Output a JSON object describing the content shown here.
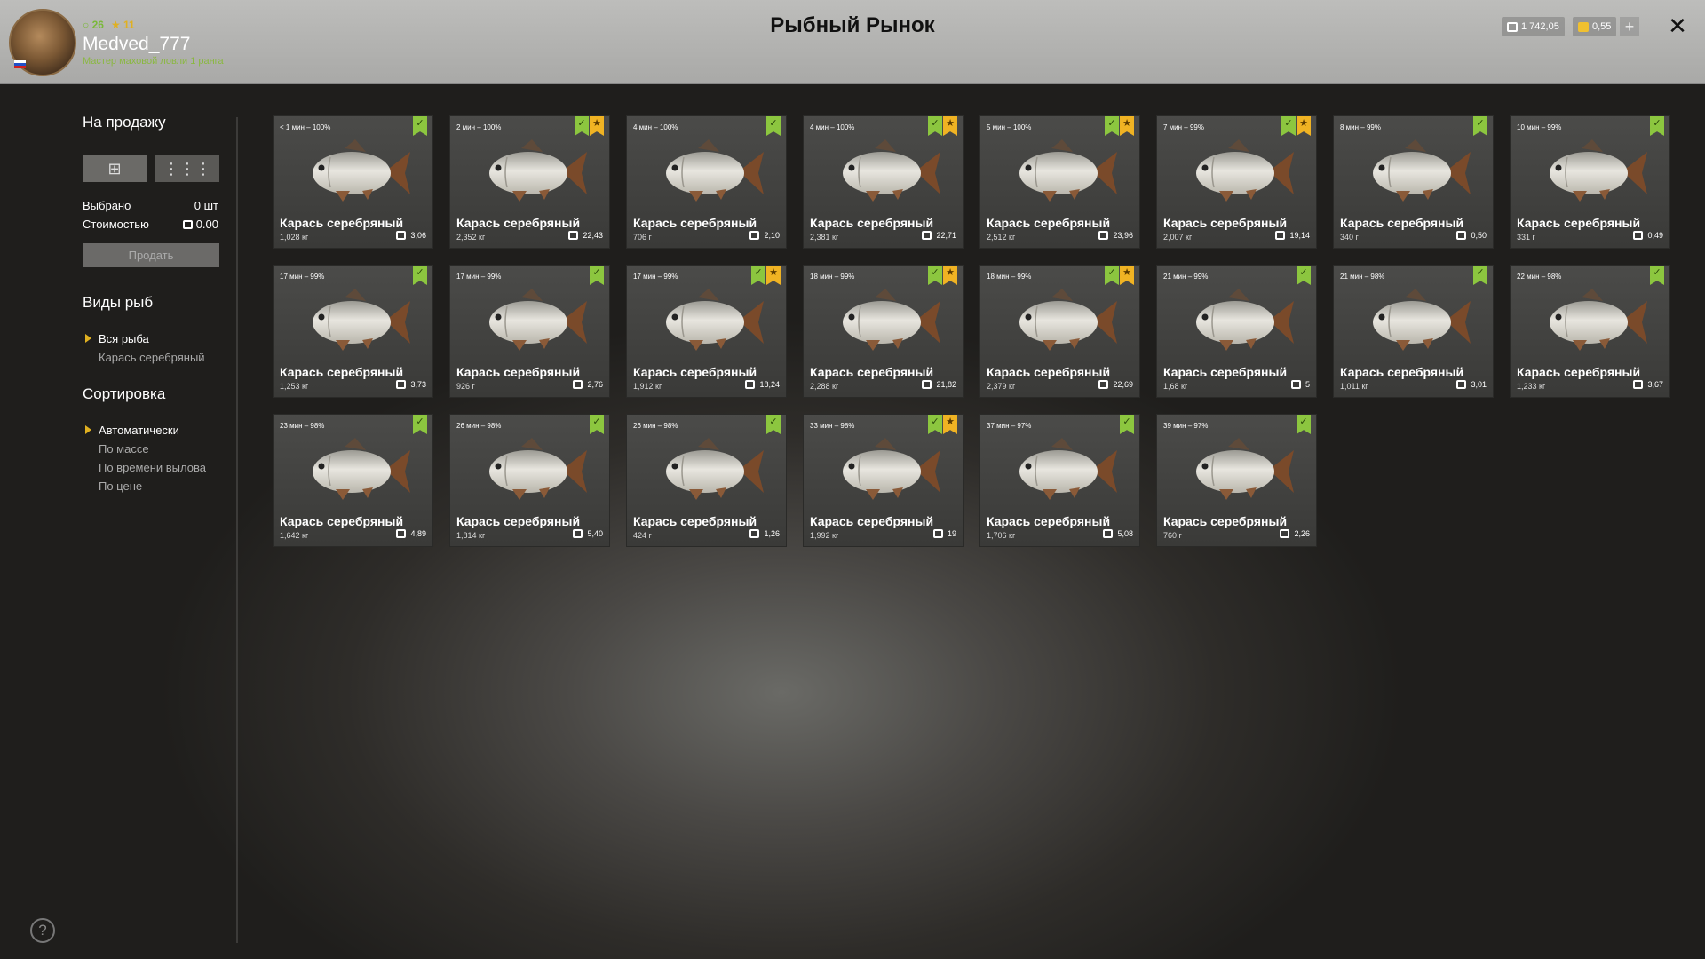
{
  "header": {
    "title": "Рыбный Рынок",
    "user": {
      "level": "26",
      "stars": "11",
      "name": "Medved_777",
      "rank_title": "Мастер маховой ловли 1 ранга"
    },
    "currency": {
      "silver": "1 742,05",
      "gold": "0,55"
    },
    "plus_label": "+",
    "close_label": "✕"
  },
  "sidebar": {
    "for_sale_heading": "На продажу",
    "selected_label": "Выбрано",
    "selected_value": "0 шт",
    "cost_label": "Стоимостью",
    "cost_value": "0.00",
    "sell_button": "Продать",
    "species_heading": "Виды рыб",
    "species": [
      "Вся рыба",
      "Карась серебряный"
    ],
    "species_selected": 0,
    "sort_heading": "Сортировка",
    "sort_options": [
      "Автоматически",
      "По массе",
      "По времени вылова",
      "По цене"
    ],
    "sort_selected": 0,
    "help_label": "?"
  },
  "fish": [
    {
      "time": "< 1 мин – 100%",
      "name": "Карась серебряный",
      "weight": "1,028 кг",
      "price": "3,06",
      "check": true,
      "star": false
    },
    {
      "time": "2 мин – 100%",
      "name": "Карась серебряный",
      "weight": "2,352 кг",
      "price": "22,43",
      "check": true,
      "star": true
    },
    {
      "time": "4 мин – 100%",
      "name": "Карась серебряный",
      "weight": "706 г",
      "price": "2,10",
      "check": true,
      "star": false
    },
    {
      "time": "4 мин – 100%",
      "name": "Карась серебряный",
      "weight": "2,381 кг",
      "price": "22,71",
      "check": true,
      "star": true
    },
    {
      "time": "5 мин – 100%",
      "name": "Карась серебряный",
      "weight": "2,512 кг",
      "price": "23,96",
      "check": true,
      "star": true
    },
    {
      "time": "7 мин – 99%",
      "name": "Карась серебряный",
      "weight": "2,007 кг",
      "price": "19,14",
      "check": true,
      "star": true
    },
    {
      "time": "8 мин – 99%",
      "name": "Карась серебряный",
      "weight": "340 г",
      "price": "0,50",
      "check": true,
      "star": false
    },
    {
      "time": "10 мин – 99%",
      "name": "Карась серебряный",
      "weight": "331 г",
      "price": "0,49",
      "check": true,
      "star": false
    },
    {
      "time": "17 мин – 99%",
      "name": "Карась серебряный",
      "weight": "1,253 кг",
      "price": "3,73",
      "check": true,
      "star": false
    },
    {
      "time": "17 мин – 99%",
      "name": "Карась серебряный",
      "weight": "926 г",
      "price": "2,76",
      "check": true,
      "star": false
    },
    {
      "time": "17 мин – 99%",
      "name": "Карась серебряный",
      "weight": "1,912 кг",
      "price": "18,24",
      "check": true,
      "star": true
    },
    {
      "time": "18 мин – 99%",
      "name": "Карась серебряный",
      "weight": "2,288 кг",
      "price": "21,82",
      "check": true,
      "star": true
    },
    {
      "time": "18 мин – 99%",
      "name": "Карась серебряный",
      "weight": "2,379 кг",
      "price": "22,69",
      "check": true,
      "star": true
    },
    {
      "time": "21 мин – 99%",
      "name": "Карась серебряный",
      "weight": "1,68 кг",
      "price": "5",
      "check": true,
      "star": false
    },
    {
      "time": "21 мин – 98%",
      "name": "Карась серебряный",
      "weight": "1,011 кг",
      "price": "3,01",
      "check": true,
      "star": false
    },
    {
      "time": "22 мин – 98%",
      "name": "Карась серебряный",
      "weight": "1,233 кг",
      "price": "3,67",
      "check": true,
      "star": false
    },
    {
      "time": "23 мин – 98%",
      "name": "Карась серебряный",
      "weight": "1,642 кг",
      "price": "4,89",
      "check": true,
      "star": false
    },
    {
      "time": "26 мин – 98%",
      "name": "Карась серебряный",
      "weight": "1,814 кг",
      "price": "5,40",
      "check": true,
      "star": false
    },
    {
      "time": "26 мин – 98%",
      "name": "Карась серебряный",
      "weight": "424 г",
      "price": "1,26",
      "check": true,
      "star": false
    },
    {
      "time": "33 мин – 98%",
      "name": "Карась серебряный",
      "weight": "1,992 кг",
      "price": "19",
      "check": true,
      "star": true
    },
    {
      "time": "37 мин – 97%",
      "name": "Карась серебряный",
      "weight": "1,706 кг",
      "price": "5,08",
      "check": true,
      "star": false
    },
    {
      "time": "39 мин – 97%",
      "name": "Карась серебряный",
      "weight": "760 г",
      "price": "2,26",
      "check": true,
      "star": false
    }
  ]
}
